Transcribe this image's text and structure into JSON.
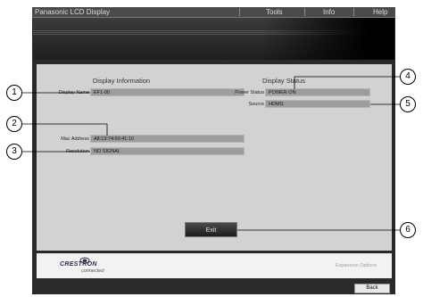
{
  "window": {
    "title": "Panasonic LCD Display",
    "menu": [
      "Tools",
      "Info",
      "Help"
    ]
  },
  "display_information": {
    "title": "Display Information",
    "rows": [
      {
        "label": "Display Name",
        "value": "EF1-00"
      },
      {
        "label": "Mac Address",
        "value": "A8:13:74:60:41:10"
      },
      {
        "label": "Resolution",
        "value": "NO SIGNAL"
      }
    ]
  },
  "display_status": {
    "title": "Display Status",
    "rows": [
      {
        "label": "Power Status",
        "value": "POWER ON"
      },
      {
        "label": "Source",
        "value": "HDMI1"
      }
    ]
  },
  "exit_label": "Exit",
  "footer": {
    "logo_text": "CRESTRON",
    "logo_sub": "connected",
    "expansion_options": "Expansion Options"
  },
  "back_label": "Back",
  "callouts": [
    "1",
    "2",
    "3",
    "4",
    "5",
    "6"
  ],
  "colors": {
    "frame": "#2a2a2a",
    "panel": "#d2d2d2",
    "field": "#9d9d9d"
  }
}
